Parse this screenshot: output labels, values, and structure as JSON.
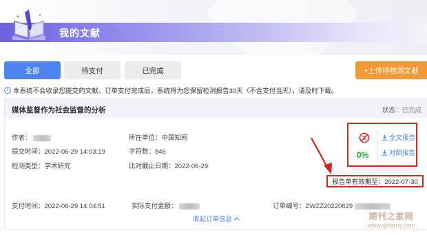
{
  "header": {
    "title": "我的文献"
  },
  "tabs": [
    {
      "label": "全部",
      "active": true
    },
    {
      "label": "待支付",
      "active": false
    },
    {
      "label": "已完成",
      "active": false
    }
  ],
  "upload_button": {
    "label": "+上传待检测文献"
  },
  "notice": "本系统不会收录您提交的文献。订单支付完成后，系统将为您保留检测报告30天（不含支付当天），请及时下载。",
  "order": {
    "title": "媒体监督作为社会监督的分析",
    "status_label": "状态：",
    "status_value": "已完成",
    "author_label": "作者：",
    "affiliation_label": "所在单位：",
    "affiliation_value": "中国知网",
    "submit_time_label": "提交时间：",
    "submit_time_value": "2022-06-29 14:03:19",
    "char_count_label": "字符数：",
    "char_count_value": "846",
    "detect_type_label": "检测类型：",
    "detect_type_value": "学术研究",
    "compare_deadline_label": "比对截止日期：",
    "compare_deadline_value": "2022-06-29",
    "result": {
      "percent": "0%",
      "full_report_label": "全文报告",
      "compare_report_label": "对照报告"
    },
    "expiry_text": "报告单有效期至：2022-07-30",
    "pay_time_label": "支付时间：",
    "pay_time_value": "2022-06-29 14:04:51",
    "actual_amount_label": "实际支付金额：",
    "order_no_label": "订单编号：",
    "order_no_value": "ZWZZ20220629",
    "collapse_label": "收起订单信息"
  },
  "watermark": {
    "line1": "期刊之家网",
    "line2": "www.qikanzj.com"
  },
  "colors": {
    "primary": "#4a85f0",
    "accent_orange": "#f29a35",
    "highlight_red": "#e0201a",
    "success_green": "#21a336"
  }
}
